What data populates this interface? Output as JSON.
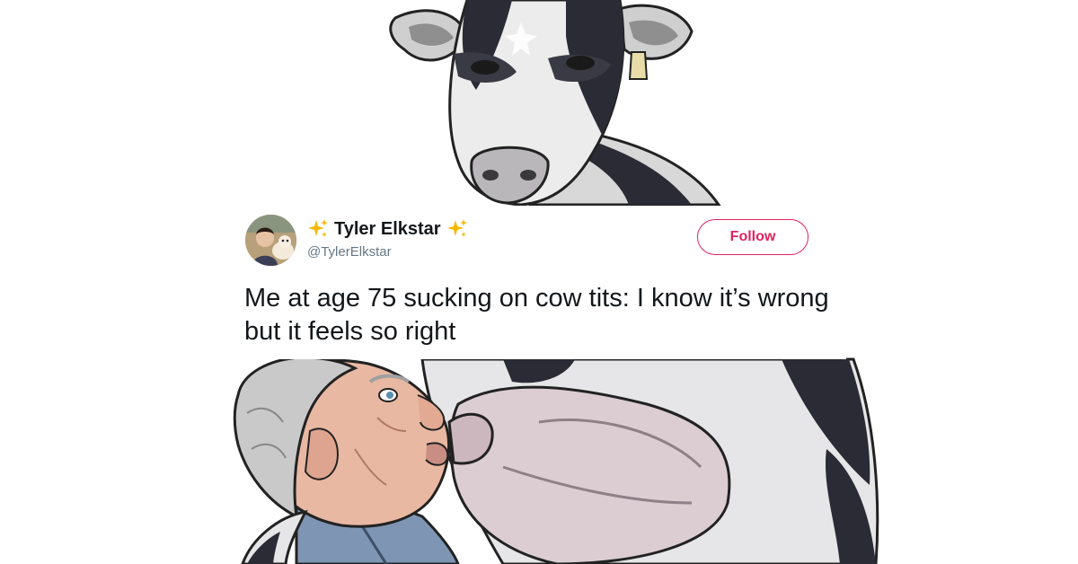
{
  "tweet": {
    "display_name": "Tyler Elkstar",
    "handle": "@TylerElkstar",
    "follow_label": "Follow",
    "text": "Me at age 75 sucking on cow tits: I know it’s wrong but it feels so right",
    "name_decoration_icon": "sparkles-icon"
  },
  "colors": {
    "follow_accent": "#e0245e",
    "name_text": "#14171a",
    "handle_text": "#657786",
    "sparkle": "#f5b800"
  },
  "illustration": {
    "top_subject": "cow-head-icon",
    "bottom_subject": "elderly-man-icon"
  }
}
